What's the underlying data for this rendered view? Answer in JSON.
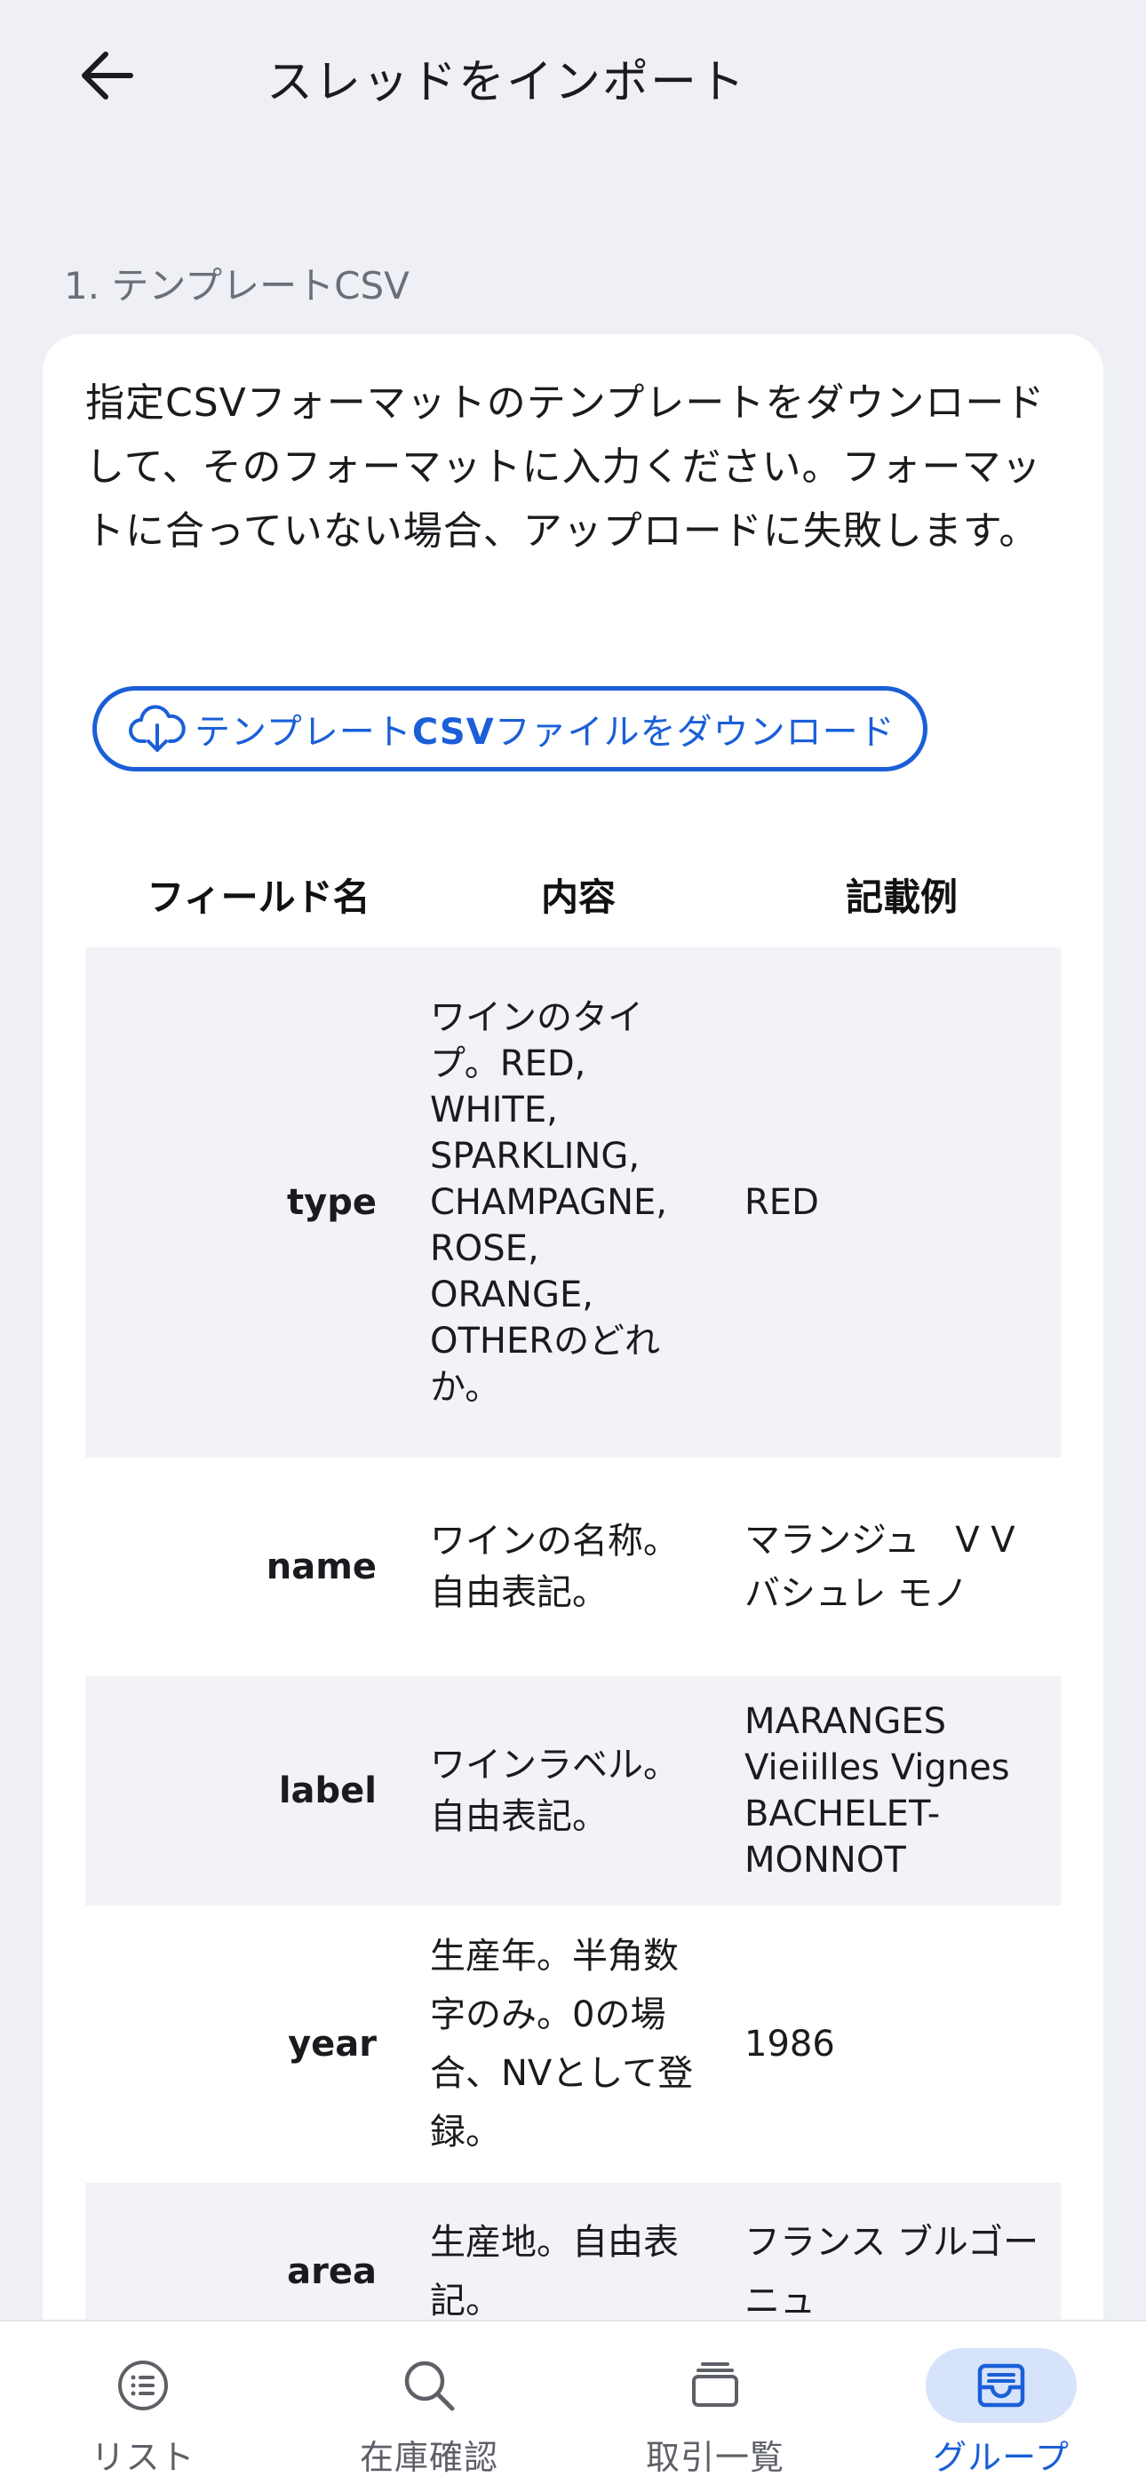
{
  "header": {
    "title": "スレッドをインポート"
  },
  "section": {
    "label": "1. テンプレートCSV"
  },
  "card": {
    "description": "指定CSVフォーマットのテンプレートをダウンロードして、そのフォーマットに入力ください。フォーマットに合っていない場合、アップロードに失敗します。",
    "download_button_prefix": "テンプレート",
    "download_button_bold": "CSV",
    "download_button_suffix": "ファイルをダウンロード"
  },
  "table": {
    "headers": {
      "field": "フィールド名",
      "content": "内容",
      "example": "記載例"
    },
    "rows": [
      {
        "field": "type",
        "content": "ワインのタイプ。RED, WHITE, SPARKLING, CHAMPAGNE, ROSE, ORANGE, OTHERのどれか。",
        "example": "RED"
      },
      {
        "field": "name",
        "content": "ワインの名称。自由表記。",
        "example": "マランジュ　V V　バシュレ モノ"
      },
      {
        "field": "label",
        "content": "ワインラベル。自由表記。",
        "example": "MARANGES Vieiilles Vignes BACHELET-MONNOT"
      },
      {
        "field": "year",
        "content": "生産年。半角数字のみ。0の場合、NVとして登録。",
        "example": "1986"
      },
      {
        "field": "area",
        "content": "生産地。自由表記。",
        "example": "フランス ブルゴーニュ"
      }
    ]
  },
  "nav": {
    "items": [
      {
        "label": "リスト",
        "icon": "list-icon",
        "active": false
      },
      {
        "label": "在庫確認",
        "icon": "search-icon",
        "active": false
      },
      {
        "label": "取引一覧",
        "icon": "stack-icon",
        "active": false
      },
      {
        "label": "グループ",
        "icon": "inbox-icon",
        "active": true
      }
    ]
  },
  "colors": {
    "accent": "#1a5fd8",
    "background": "#eef0f6",
    "card": "#ffffff",
    "row_alt": "#f2f3f7",
    "nav_active_pill": "#d7e3fa"
  }
}
